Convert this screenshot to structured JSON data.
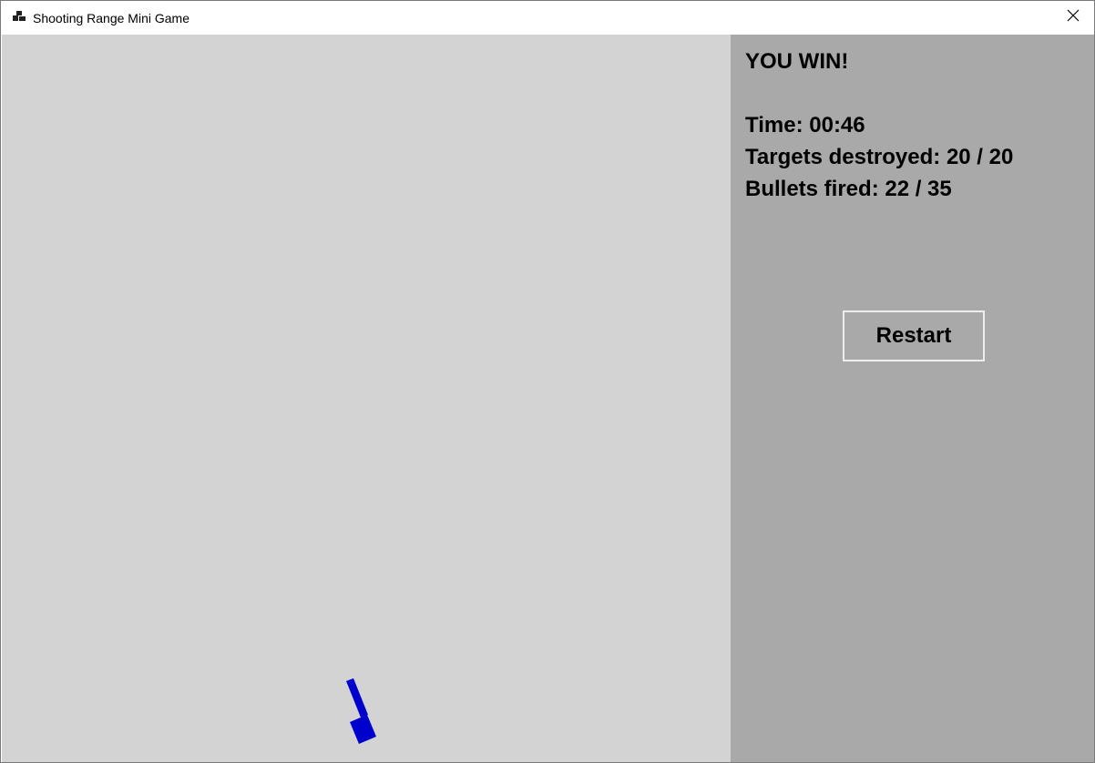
{
  "window": {
    "title": "Shooting Range Mini Game",
    "icon": "app-window-icon",
    "close_icon": "close-icon"
  },
  "game": {
    "background_color": "#d3d3d3",
    "cannon_color": "#0000cd",
    "cannon_icon": "cannon-icon"
  },
  "panel": {
    "background_color": "#a9a9a9",
    "status": "YOU WIN!",
    "time": "Time: 00:46",
    "targets": "Targets destroyed: 20 / 20",
    "bullets": "Bullets fired: 22 / 35",
    "restart_label": "Restart"
  }
}
